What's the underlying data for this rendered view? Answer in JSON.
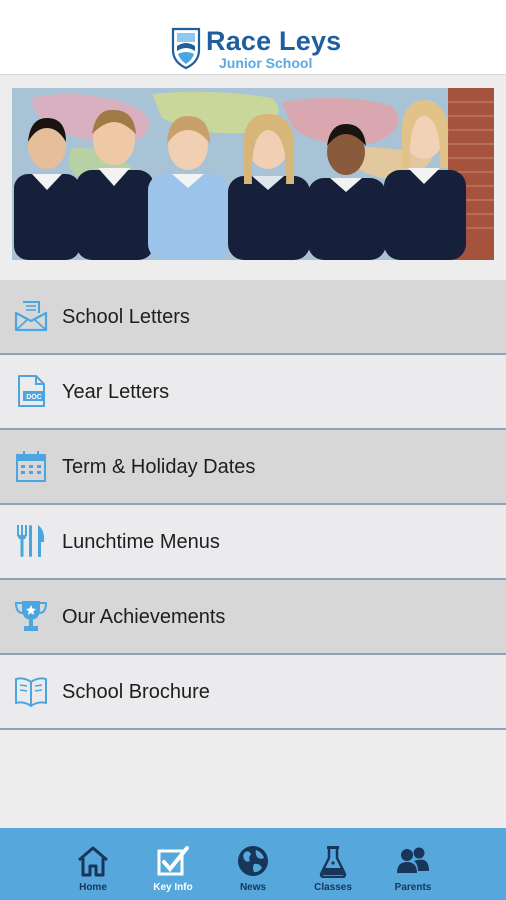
{
  "header": {
    "title": "Race Leys",
    "subtitle": "Junior School",
    "logo_icon": "school-crest-icon"
  },
  "banner": {
    "description_icon": "school-children-photo"
  },
  "menu": {
    "items": [
      {
        "label": "School Letters",
        "icon": "envelope-icon"
      },
      {
        "label": "Year Letters",
        "icon": "doc-file-icon"
      },
      {
        "label": "Term & Holiday Dates",
        "icon": "calendar-icon"
      },
      {
        "label": "Lunchtime Menus",
        "icon": "cutlery-icon"
      },
      {
        "label": "Our Achievements",
        "icon": "trophy-icon"
      },
      {
        "label": "School Brochure",
        "icon": "open-book-icon"
      }
    ]
  },
  "tabbar": {
    "tabs": [
      {
        "label": "Home",
        "icon": "home-icon"
      },
      {
        "label": "Key Info",
        "icon": "checkbox-icon"
      },
      {
        "label": "News",
        "icon": "globe-icon"
      },
      {
        "label": "Classes",
        "icon": "flask-icon"
      },
      {
        "label": "Parents",
        "icon": "people-icon"
      }
    ]
  },
  "colors": {
    "brand_dark": "#1f5f9e",
    "brand_light": "#59a9e0",
    "tabbar": "#56a7dc",
    "icon_blue": "#4ba6e0"
  }
}
